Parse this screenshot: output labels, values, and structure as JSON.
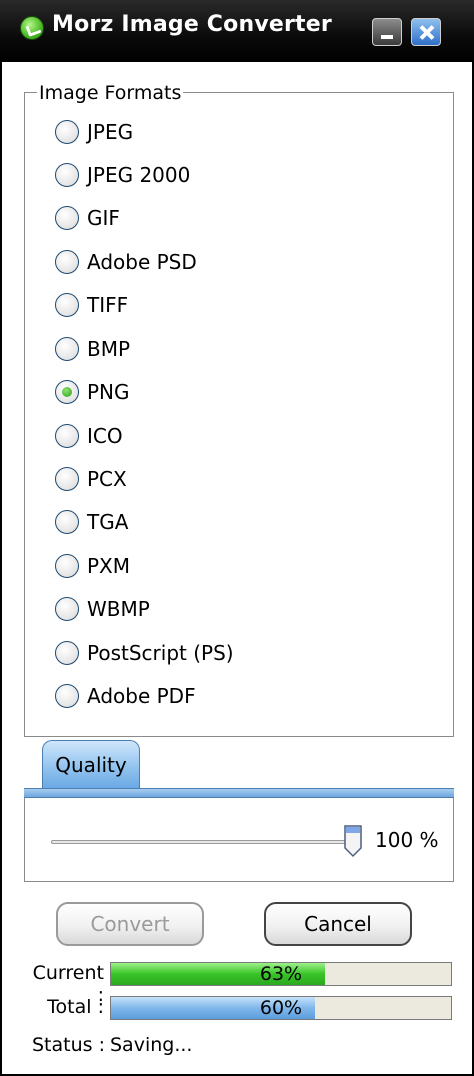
{
  "window": {
    "title": "Morz Image Converter"
  },
  "formats": {
    "legend": "Image Formats",
    "selected": "PNG",
    "options": [
      {
        "label": "JPEG",
        "checked": false
      },
      {
        "label": "JPEG 2000",
        "checked": false
      },
      {
        "label": "GIF",
        "checked": false
      },
      {
        "label": "Adobe PSD",
        "checked": false
      },
      {
        "label": "TIFF",
        "checked": false
      },
      {
        "label": "BMP",
        "checked": false
      },
      {
        "label": "PNG",
        "checked": true
      },
      {
        "label": "ICO",
        "checked": false
      },
      {
        "label": "PCX",
        "checked": false
      },
      {
        "label": "TGA",
        "checked": false
      },
      {
        "label": "PXM",
        "checked": false
      },
      {
        "label": "WBMP",
        "checked": false
      },
      {
        "label": "PostScript (PS)",
        "checked": false
      },
      {
        "label": "Adobe PDF",
        "checked": false
      }
    ]
  },
  "quality": {
    "tab_label": "Quality",
    "value_text": "100 %",
    "level": 100
  },
  "buttons": {
    "convert": "Convert",
    "cancel": "Cancel"
  },
  "progress": {
    "current_label": "Current :",
    "current_text": "63%",
    "current_value": 63,
    "total_label": "Total :",
    "total_text": "60%",
    "total_value": 60
  },
  "status": {
    "label": "Status :",
    "value": "Saving..."
  },
  "colors": {
    "current_fill": "#38c428",
    "total_fill": "#7fb7ea",
    "tab_accent": "#8ec1ee"
  }
}
